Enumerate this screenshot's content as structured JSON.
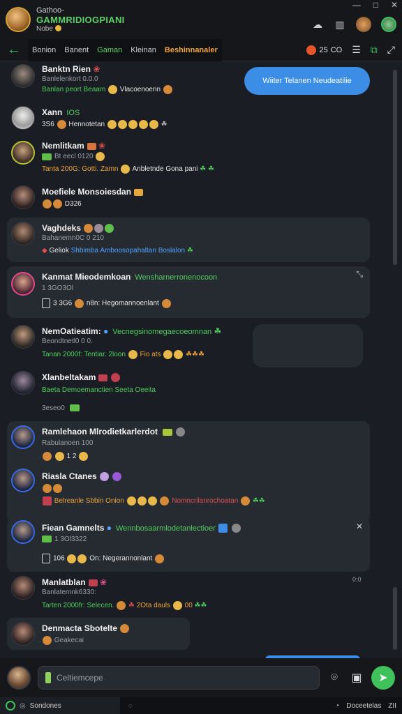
{
  "window": {
    "subtitle": "Gathoo-",
    "app_name": "GAMMRIDIOGPIANI",
    "status": "Nobe",
    "minimize": "—",
    "maximize": "□",
    "close": "✕"
  },
  "nav": {
    "back": "←",
    "tabs": [
      {
        "label": "Bonion"
      },
      {
        "label": "Banent"
      },
      {
        "label": "Gaman"
      },
      {
        "label": "Kleinan"
      },
      {
        "label": "Beshinnanaler"
      }
    ],
    "badge_count": "25",
    "badge_suffix": "CO",
    "menu": "☰",
    "screen_icon": "⧉",
    "expand_icon": "⤢"
  },
  "bubble_top": "Wiiter Telanen Neudeatilie",
  "messages": [
    {
      "name": "Banktn Rien",
      "sub": "Banlelenkort 0.0.0",
      "text": "Banlan peort Beaam",
      "text2": "Vlacoenoenn"
    },
    {
      "name": "Xann",
      "extra": "IOS",
      "text": "3S6",
      "text2": "Hennotetan"
    },
    {
      "name": "Nemlitkam",
      "sub": "Bt eecl 0120",
      "text": "Tanta 200G: Gotti. Zamn",
      "text2": "Anbletnde Gona pani"
    },
    {
      "name": "Moefiele Monsoiesdan",
      "text": "D326"
    },
    {
      "name": "Vaghdeks",
      "sub": "Bahanemn0C 0 210",
      "text": "Geliok",
      "text2": "Shbimba Amboosopahaltan Boslalon"
    },
    {
      "name": "Kanmat Mieodemkoan",
      "extra": "Wensharnerronenocoon",
      "sub": "1 3GO3Ol",
      "text": "3 3G6",
      "text2": "n8n: Hegomannoenlant"
    },
    {
      "name": "NemOatieatim:",
      "extra": "Vecnegsinomegaecoeomnan",
      "sub": "Beondtnetl0 0 0.",
      "text": "Tanan 2000f: Tentiar. 2loon",
      "text2": "Fio ats"
    },
    {
      "name": "Xlanbeltakam",
      "text": "Baeta Demoemanctien Seeta Oeeita",
      "sub": "3eseo0"
    },
    {
      "name": "Ramlehaon Mlrodietkarlerdot",
      "sub": "Rabulanoen 100",
      "text": "1 2"
    },
    {
      "name": "Riasla Ctanes",
      "text": "Belreanle Sbbin Onion",
      "text2": "Nomncrilanrochoatan"
    },
    {
      "name": "Fiean Gamnelts",
      "extra": "Wennbosaarmlodetanlectioer",
      "sub": "1 3Ol3322",
      "text": "106",
      "text2": "On: Negerannonlant"
    },
    {
      "name": "Manlatblan",
      "sub": "Banlatemnk6330:",
      "text": "Tarten 2000fr: Selecen.",
      "text2": "2Ota dauls",
      "text3": "00"
    },
    {
      "name": "Denmacta Sbotelte",
      "sub": "Geakecai"
    }
  ],
  "side_timestamp": "0:0",
  "composer": {
    "placeholder": "Celtiemcepe",
    "send": "➤",
    "camera": "⌾",
    "image": "▣"
  },
  "statusbar": {
    "left_label": "Sondones",
    "right_label": "Doceetelas",
    "icon_label": "ZII"
  }
}
